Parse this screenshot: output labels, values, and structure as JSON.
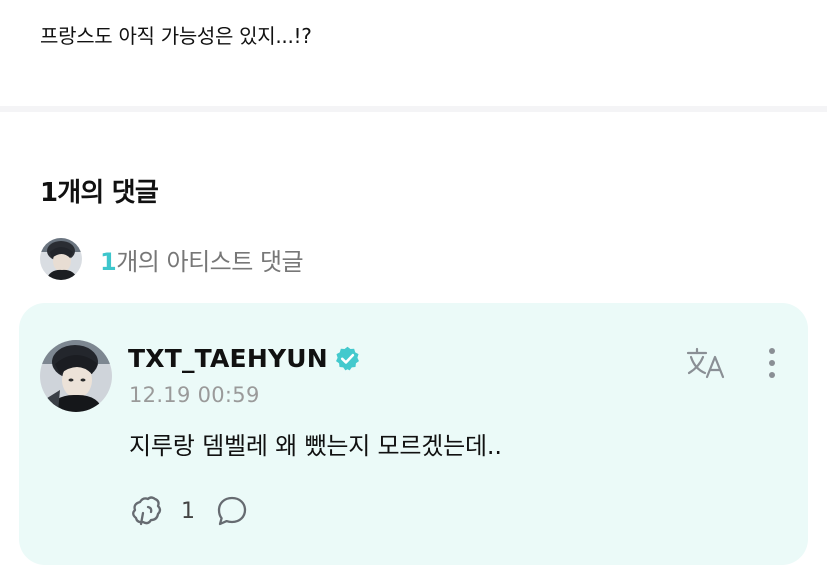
{
  "post": {
    "text": "프랑스도 아직 가능성은 있지...!?"
  },
  "comments": {
    "heading": "1개의 댓글",
    "artist_summary": {
      "count": "1",
      "label": "개의 아티스트 댓글"
    },
    "items": [
      {
        "author": "TXT_TAEHYUN",
        "verified": true,
        "timestamp": "12.19 00:59",
        "body": "지루랑 뎀벨레 왜 뺐는지 모르겠는데..",
        "like_count": "1",
        "icons": {
          "translate": "translate-icon",
          "more": "more-vertical-icon",
          "like": "weverse-like-icon",
          "reply": "reply-bubble-icon",
          "verified": "verified-badge-icon"
        }
      }
    ]
  },
  "colors": {
    "accent": "#3ec6cc",
    "card_background": "#ebfaf8",
    "muted_text": "#9a9a9a"
  }
}
